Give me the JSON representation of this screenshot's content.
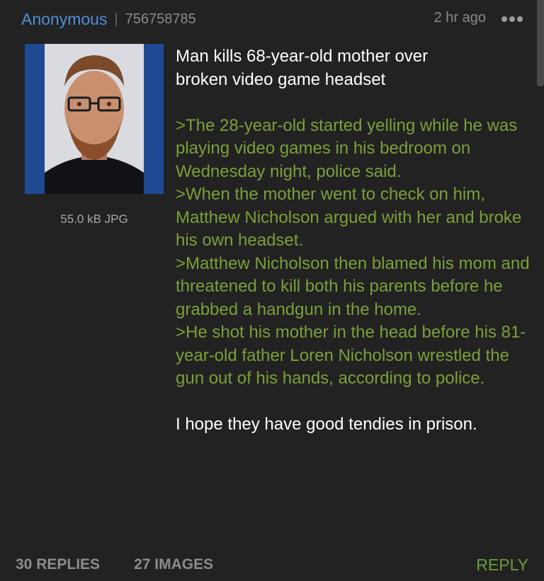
{
  "header": {
    "author": "Anonymous",
    "separator": "|",
    "post_number": "756758785",
    "time_ago": "2 hr ago"
  },
  "thumbnail": {
    "file_info": "55.0 kB JPG"
  },
  "post": {
    "title_lines": [
      "Man kills 68-year-old mother over",
      "broken video game headset"
    ],
    "quotes": [
      ">The 28-year-old started yelling while he was playing video games in his bedroom on Wednesday night, police said.",
      ">When the mother went to check on him, Matthew Nicholson argued with her and broke his own headset.",
      ">Matthew Nicholson then blamed his mom and threatened to kill both his parents before he grabbed a handgun in the home.",
      ">He shot his mother in the head before his 81-year-old father Loren Nicholson wrestled the gun out of his hands, according to police."
    ],
    "closing": "I hope they have good tendies in prison."
  },
  "footer": {
    "replies": "30 REPLIES",
    "images": "27 IMAGES",
    "reply_button": "REPLY"
  },
  "colors": {
    "background": "#222222",
    "author": "#4f8fd8",
    "greentext": "#7aa03a",
    "reply": "#6b9b3a"
  },
  "icons": [
    "overflow-menu-icon"
  ]
}
